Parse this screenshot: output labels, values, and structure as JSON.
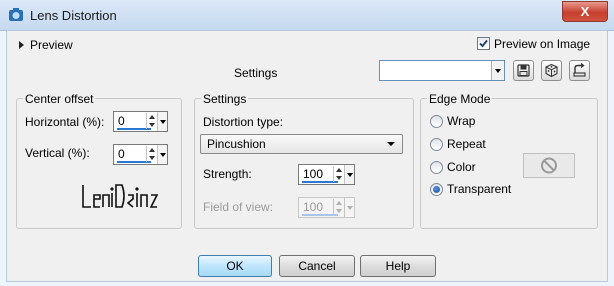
{
  "window": {
    "title": "Lens Distortion",
    "close_label": "X"
  },
  "preview": {
    "label": "Preview"
  },
  "preview_on_image": {
    "label": "Preview on Image",
    "checked": true
  },
  "presets": {
    "label": "Settings",
    "value": ""
  },
  "center_offset": {
    "legend": "Center offset",
    "horizontal_label": "Horizontal (%):",
    "horizontal_value": "0",
    "vertical_label": "Vertical (%):",
    "vertical_value": "0"
  },
  "settings": {
    "legend": "Settings",
    "distortion_type_label": "Distortion type:",
    "distortion_type_value": "Pincushion",
    "strength_label": "Strength:",
    "strength_value": "100",
    "field_of_view_label": "Field of view:",
    "field_of_view_value": "100"
  },
  "edge_mode": {
    "legend": "Edge Mode",
    "options": [
      "Wrap",
      "Repeat",
      "Color",
      "Transparent"
    ],
    "selected": "Transparent"
  },
  "buttons": {
    "ok": "OK",
    "cancel": "Cancel",
    "help": "Help"
  },
  "colors": {
    "accent_blue": "#2a78d6",
    "close_red": "#c7402e"
  }
}
